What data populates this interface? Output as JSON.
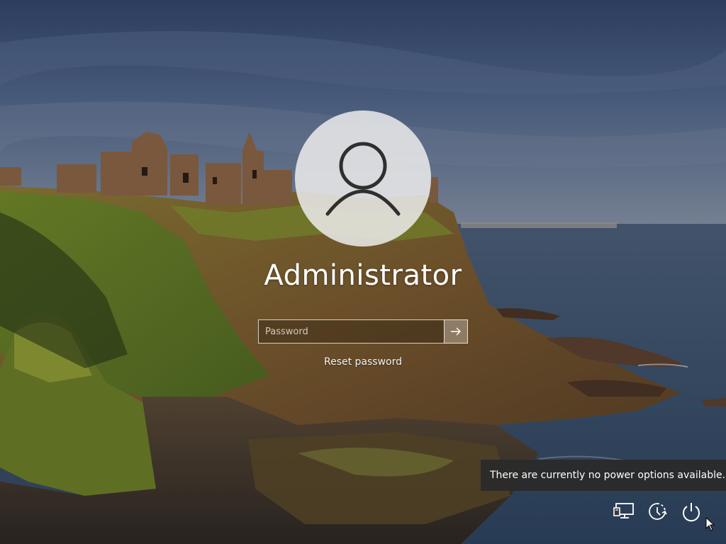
{
  "login": {
    "username": "Administrator",
    "password_placeholder": "Password",
    "reset_link": "Reset password"
  },
  "tooltip": {
    "text": "There are currently no power options available."
  },
  "system_buttons": [
    {
      "name": "network",
      "icon": "network-icon"
    },
    {
      "name": "ease-of-access",
      "icon": "ease-of-access-icon"
    },
    {
      "name": "power",
      "icon": "power-icon"
    }
  ],
  "colors": {
    "text": "#ffffff",
    "tooltip_bg": "#2b2b2b",
    "sea": "#3d5470",
    "sky": "#4a5e82"
  }
}
